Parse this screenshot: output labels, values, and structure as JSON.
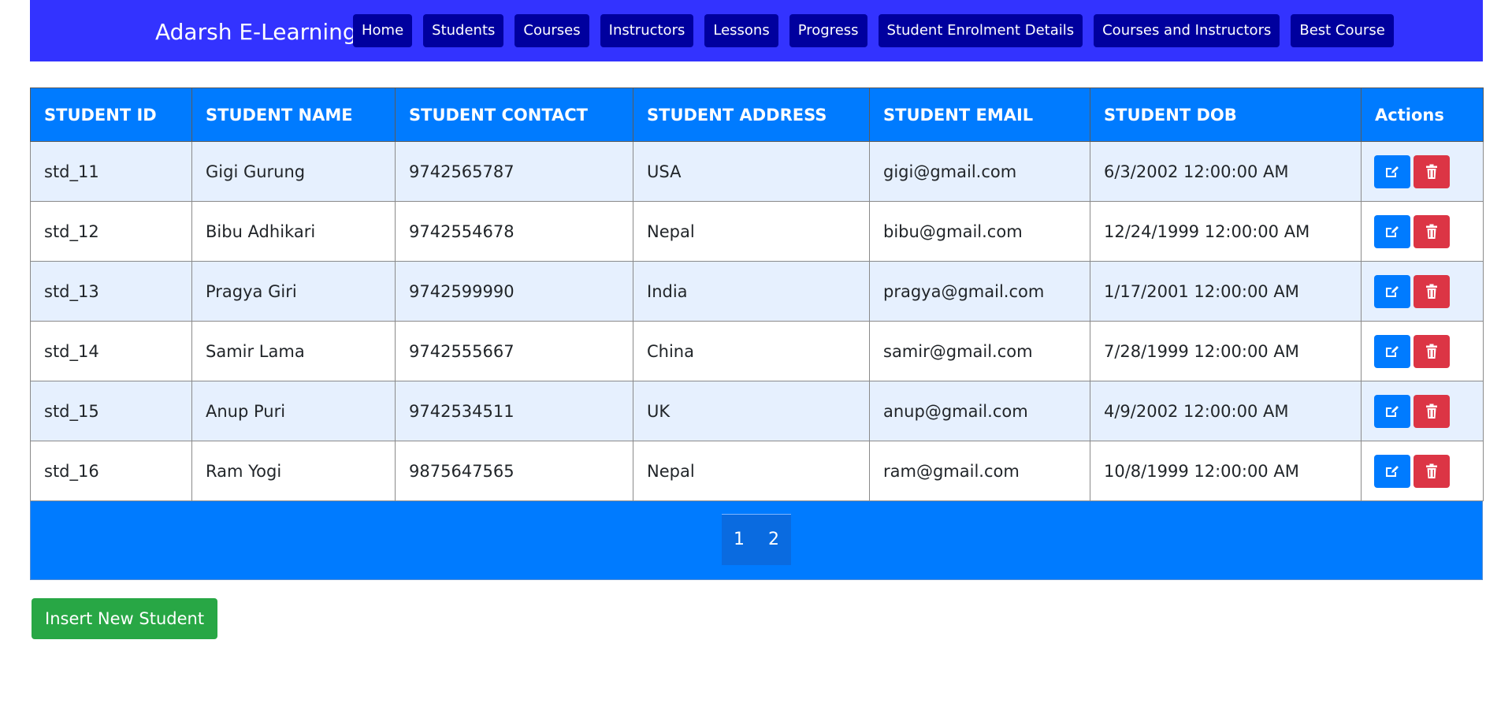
{
  "navbar": {
    "brand": "Adarsh E-Learning",
    "links": [
      "Home",
      "Students",
      "Courses",
      "Instructors",
      "Lessons",
      "Progress",
      "Student Enrolment Details",
      "Courses and Instructors",
      "Best Course"
    ],
    "color": "#3333ff",
    "link_bg": "#00009e"
  },
  "table": {
    "headers": [
      "STUDENT ID",
      "STUDENT NAME",
      "STUDENT CONTACT",
      "STUDENT ADDRESS",
      "STUDENT EMAIL",
      "STUDENT DOB",
      "Actions"
    ],
    "rows": [
      [
        "std_11",
        "Gigi Gurung",
        "9742565787",
        "USA",
        "gigi@gmail.com",
        "6/3/2002 12:00:00 AM"
      ],
      [
        "std_12",
        "Bibu Adhikari",
        "9742554678",
        "Nepal",
        "bibu@gmail.com",
        "12/24/1999 12:00:00 AM"
      ],
      [
        "std_13",
        "Pragya Giri",
        "9742599990",
        "India",
        "pragya@gmail.com",
        "1/17/2001 12:00:00 AM"
      ],
      [
        "std_14",
        "Samir Lama",
        "9742555667",
        "China",
        "samir@gmail.com",
        "7/28/1999 12:00:00 AM"
      ],
      [
        "std_15",
        "Anup Puri",
        "9742534511",
        "UK",
        "anup@gmail.com",
        "4/9/2002 12:00:00 AM"
      ],
      [
        "std_16",
        "Ram Yogi",
        "9875647565",
        "Nepal",
        "ram@gmail.com",
        "10/8/1999 12:00:00 AM"
      ]
    ],
    "row_actions": [
      "edit-icon",
      "delete-icon"
    ],
    "header_color": "#007bff",
    "stripe_color": "#e6f0fe"
  },
  "pagination": {
    "pages": [
      "1",
      "2"
    ]
  },
  "insert_button": {
    "label": "Insert New Student",
    "color": "#28a745"
  },
  "colors": {
    "edit": "#007bff",
    "delete": "#dc3545"
  }
}
